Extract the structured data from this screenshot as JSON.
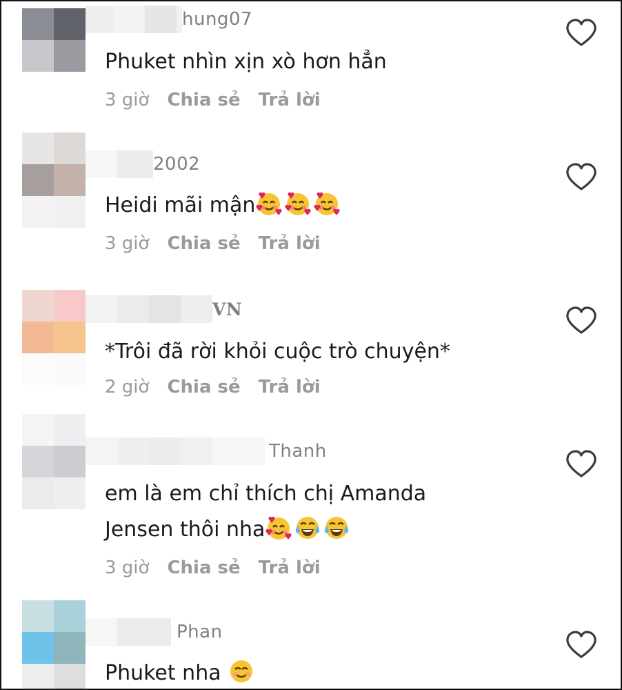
{
  "comments": [
    {
      "username": "hung07",
      "text": "Phuket nhìn xịn xò hơn hẳn",
      "time": "3 giờ",
      "share_label": "Chia sẻ",
      "reply_label": "Trả lời",
      "emojis": [],
      "avatar_colors": [
        "#8a8d93",
        "#5f6268",
        "#c8c8cc",
        "#9a9aa0",
        "#ededed",
        "#ededed"
      ]
    },
    {
      "username": "2002",
      "text": "Heidi mãi mận",
      "time": "3 giờ",
      "share_label": "Chia sẻ",
      "reply_label": "Trả lời",
      "emojis": [
        "smiling-face-with-hearts-icon",
        "smiling-face-with-hearts-icon",
        "smiling-face-with-hearts-icon"
      ],
      "avatar_colors": [
        "#e8e6e4",
        "#dcd9d6",
        "#a69f9d",
        "#c4b1ab",
        "#f3f1f2",
        "#f1f0f1"
      ]
    },
    {
      "username": "VN",
      "text": "*Trôi đã rời khỏi cuộc trò chuyện*",
      "time": "2 giờ",
      "share_label": "Chia sẻ",
      "reply_label": "Trả lời",
      "emojis": [],
      "avatar_colors": [
        "#f0d6d0",
        "#f8c9c9",
        "#f2b994",
        "#f6c48e",
        "#fbfbfb",
        "#fafafa"
      ]
    },
    {
      "username": "Thanh",
      "line1": "em là em chỉ thích chị Amanda",
      "line2": "Jensen thôi nha",
      "time": "3 giờ",
      "share_label": "Chia sẻ",
      "reply_label": "Trả lời",
      "emojis": [
        "smiling-face-with-hearts-icon",
        "tears-of-joy-icon",
        "tears-of-joy-icon"
      ],
      "avatar_colors": [
        "#f5f5f5",
        "#efeff1",
        "#d6d5da",
        "#cdccd3",
        "#ececed",
        "#efeff0"
      ]
    },
    {
      "username": "Phan",
      "text": "Phuket nha",
      "emojis": [
        "smiling-face-icon"
      ],
      "avatar_colors": [
        "#c8dfe2",
        "#a9d1da",
        "#6ec3ea",
        "#8fb6bb",
        "#ededed",
        "#dedede"
      ]
    }
  ],
  "colors": {
    "text": "#1a1a1a",
    "meta": "#9a9a9a",
    "heart_stroke": "#3a3a3a",
    "frame_border": "#111111"
  }
}
